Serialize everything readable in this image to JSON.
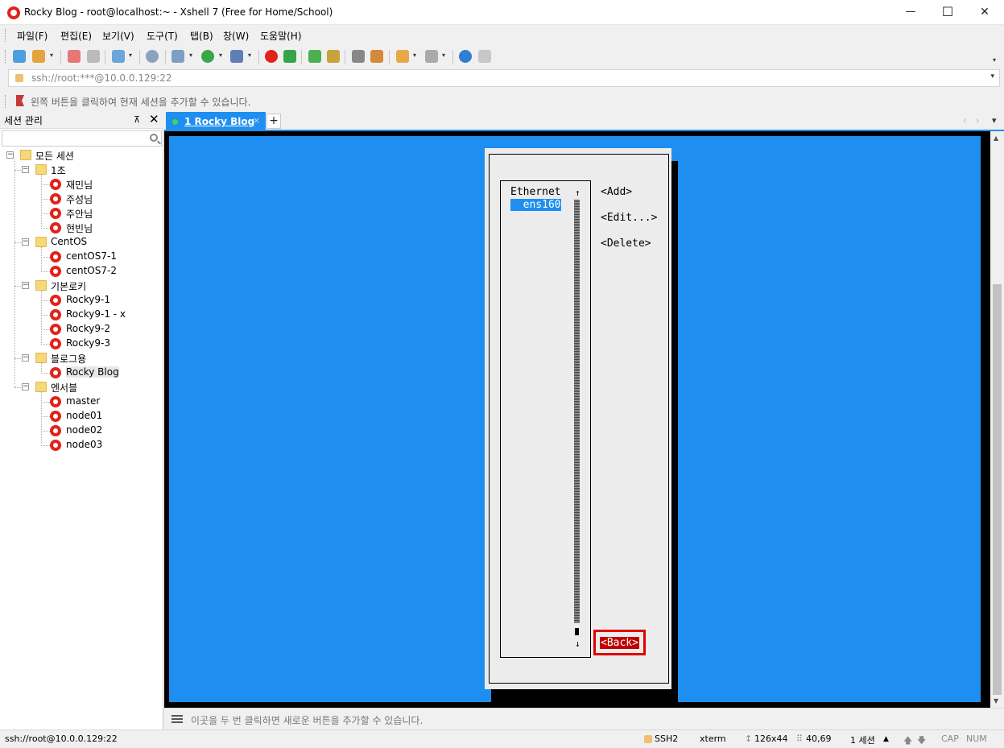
{
  "window": {
    "title": "Rocky Blog - root@localhost:~ - Xshell 7 (Free for Home/School)",
    "minimize": "—",
    "maximize": "☐",
    "close": "✕"
  },
  "menu": [
    "파일(F)",
    "편집(E)",
    "보기(V)",
    "도구(T)",
    "탭(B)",
    "창(W)",
    "도움말(H)"
  ],
  "address": {
    "value": "ssh://root:***@10.0.0.129:22",
    "dropdown": "▾"
  },
  "hint": "왼쪽 버튼을 클릭하여 현재 세션을 추가할 수 있습니다.",
  "session_panel": {
    "title": "세션 관리",
    "pin": "⊼",
    "close": "✕",
    "search_placeholder": "",
    "tree": {
      "root": "모든 세션",
      "folders": [
        {
          "name": "1조",
          "sessions": [
            "재민님",
            "주성님",
            "주안님",
            "현빈님"
          ]
        },
        {
          "name": "CentOS",
          "sessions": [
            "centOS7-1",
            "centOS7-2"
          ]
        },
        {
          "name": "기본로키",
          "sessions": [
            "Rocky9-1",
            "Rocky9-1 - x",
            "Rocky9-2",
            "Rocky9-3"
          ]
        },
        {
          "name": "블로그용",
          "sessions": [
            "Rocky Blog"
          ]
        },
        {
          "name": "엔서블",
          "sessions": [
            "master",
            "node01",
            "node02",
            "node03"
          ]
        }
      ]
    }
  },
  "tabs": {
    "active": {
      "number": "1",
      "label": "1 Rocky Blog",
      "close": "×"
    },
    "add": "+",
    "prev": "‹",
    "next": "›",
    "menu": "▾"
  },
  "terminal": {
    "list_header": "Ethernet",
    "list_items": [
      "  ens160"
    ],
    "scroll_up": "↑",
    "scroll_down": "↓",
    "buttons": {
      "add": "<Add>",
      "edit": "<Edit...>",
      "delete": "<Delete>",
      "back": "<Back>"
    }
  },
  "quickbar": {
    "text": "이곳을 두 번 클릭하면 새로운 버튼을 추가할 수 있습니다."
  },
  "status": {
    "connection": "ssh://root@10.0.0.129:22",
    "protocol": "SSH2",
    "terminal_type": "xterm",
    "size": "126x44",
    "cursor": "40,69",
    "sessions": "1 세션",
    "caps": "CAP",
    "num": "NUM"
  },
  "colors": {
    "accent": "#1e8ff0",
    "back_button": "#c00000",
    "highlight": "#e10000",
    "brand": "#e2231a"
  }
}
